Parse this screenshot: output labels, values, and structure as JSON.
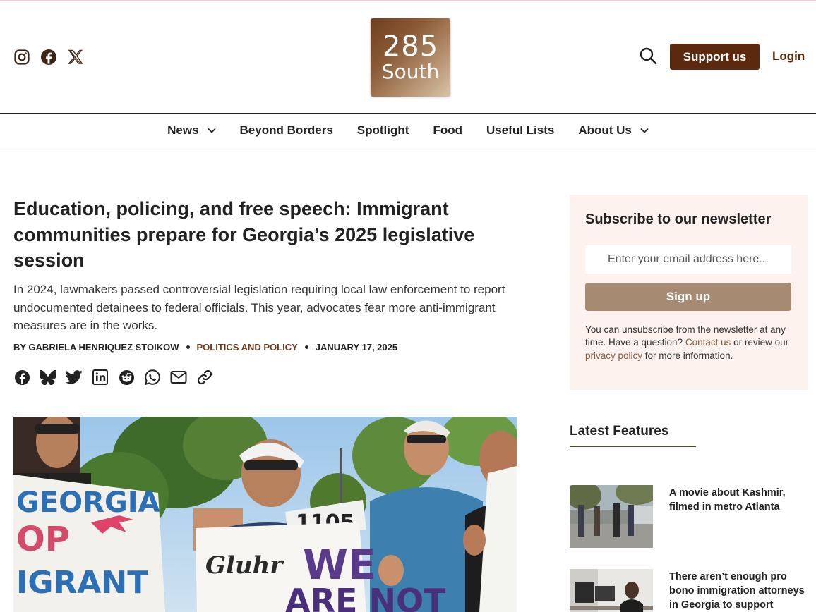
{
  "header": {
    "social": [
      {
        "name": "instagram-icon"
      },
      {
        "name": "facebook-icon"
      },
      {
        "name": "x-icon"
      }
    ],
    "logo": {
      "number": "285",
      "word": "South"
    },
    "support_label": "Support us",
    "login_label": "Login"
  },
  "nav": {
    "items": [
      {
        "label": "News",
        "has_dropdown": true
      },
      {
        "label": "Beyond Borders",
        "has_dropdown": false
      },
      {
        "label": "Spotlight",
        "has_dropdown": false
      },
      {
        "label": "Food",
        "has_dropdown": false
      },
      {
        "label": "Useful Lists",
        "has_dropdown": false
      },
      {
        "label": "About Us",
        "has_dropdown": true
      }
    ]
  },
  "article": {
    "headline": "Education, policing, and free speech: Immigrant communities prepare for Georgia’s 2025 legislative session",
    "dek": "In 2024, lawmakers passed controversial legislation requiring local law enforcement to report undocumented detainees to federal officials. This year, advocates fear more anti-immigrant measures are in the works.",
    "byline": "BY GABRIELA HENRIQUEZ STOIKOW",
    "category": "POLITICS AND POLICY",
    "date": "JANUARY 17, 2025",
    "share": [
      "facebook-icon",
      "bluesky-icon",
      "twitter-icon",
      "linkedin-icon",
      "reddit-icon",
      "whatsapp-icon",
      "email-icon",
      "link-icon"
    ],
    "hero": {
      "sign_left": "GEORGIA",
      "sign_left_2": "OP",
      "sign_left_3": "IGRANT",
      "sign_center_script": "Gluhr",
      "sign_center_big": "WE",
      "sign_center_big_2": "ARE NOT",
      "sign_small": "1105"
    }
  },
  "sidebar": {
    "newsletter": {
      "title": "Subscribe to our newsletter",
      "placeholder": "Enter your email address here...",
      "button": "Sign up",
      "note_prefix": "You can unsubscribe from the newsletter at any time. Have a question? ",
      "note_link1": "Contact us",
      "note_mid": " or review our ",
      "note_link2": "privacy policy",
      "note_suffix": " for more information."
    },
    "latest_title": "Latest Features",
    "features": [
      {
        "title": "A movie about Kashmir, filmed in metro Atlanta"
      },
      {
        "title": "There aren’t enough pro bono immigration attorneys in Georgia to support people"
      }
    ]
  },
  "colors": {
    "brand_brown": "#5b2a0e",
    "category_brown": "#6b3a1c",
    "signup_tan": "#a68a72",
    "newsletter_bg": "#fdf2ee"
  }
}
